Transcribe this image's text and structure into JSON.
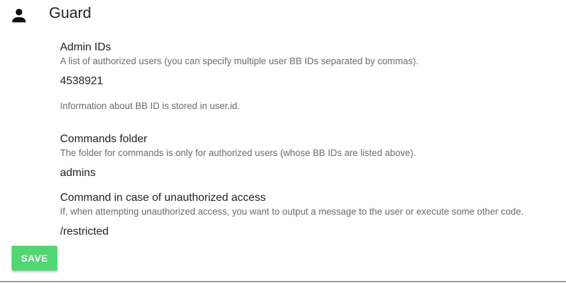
{
  "header": {
    "icon": "person-icon",
    "title": "Guard"
  },
  "fields": {
    "admin_ids": {
      "label": "Admin IDs",
      "hint": "A list of authorized users (you can specify multiple user BB IDs separated by commas).",
      "value": "4538921",
      "info": "Information about BB ID is stored in user.id."
    },
    "commands_folder": {
      "label": "Commands folder",
      "hint": "The folder for commands is only for authorized users (whose BB IDs are listed above).",
      "value": "admins"
    },
    "unauthorized_command": {
      "label": "Command in case of unauthorized access",
      "hint": "If, when attempting unauthorized access, you want to output a message to the user or execute some other code.",
      "value": "/restricted"
    }
  },
  "actions": {
    "save_label": "SAVE"
  },
  "colors": {
    "save_button": "#52d672",
    "text_primary": "#212121",
    "text_secondary": "#6b6b6b",
    "divider": "#9e9e9e"
  }
}
